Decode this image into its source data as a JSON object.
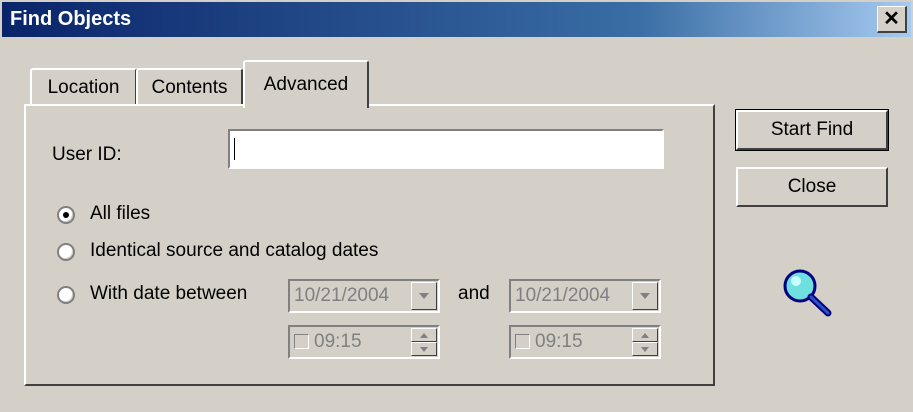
{
  "window": {
    "title": "Find Objects",
    "close_glyph": "✕"
  },
  "tabs": [
    {
      "label": "Location",
      "active": false
    },
    {
      "label": "Contents",
      "active": false
    },
    {
      "label": "Advanced",
      "active": true
    }
  ],
  "advanced": {
    "user_id_label": "User ID:",
    "user_id_value": "",
    "radios": [
      {
        "label": "All files",
        "selected": true
      },
      {
        "label": "Identical source and catalog dates",
        "selected": false
      },
      {
        "label": "With date between",
        "selected": false
      }
    ],
    "and_label": "and",
    "date_from": "10/21/2004",
    "date_to": "10/21/2004",
    "time_from": "09:15",
    "time_to": "09:15"
  },
  "buttons": {
    "start_find": "Start Find",
    "close": "Close"
  },
  "icons": {
    "find": "magnifier-icon",
    "close": "close-icon",
    "dropdown": "chevron-down-icon"
  },
  "colors": {
    "titlebar": "#0a246a",
    "face": "#d4d0c8",
    "disabled_text": "#808080"
  }
}
